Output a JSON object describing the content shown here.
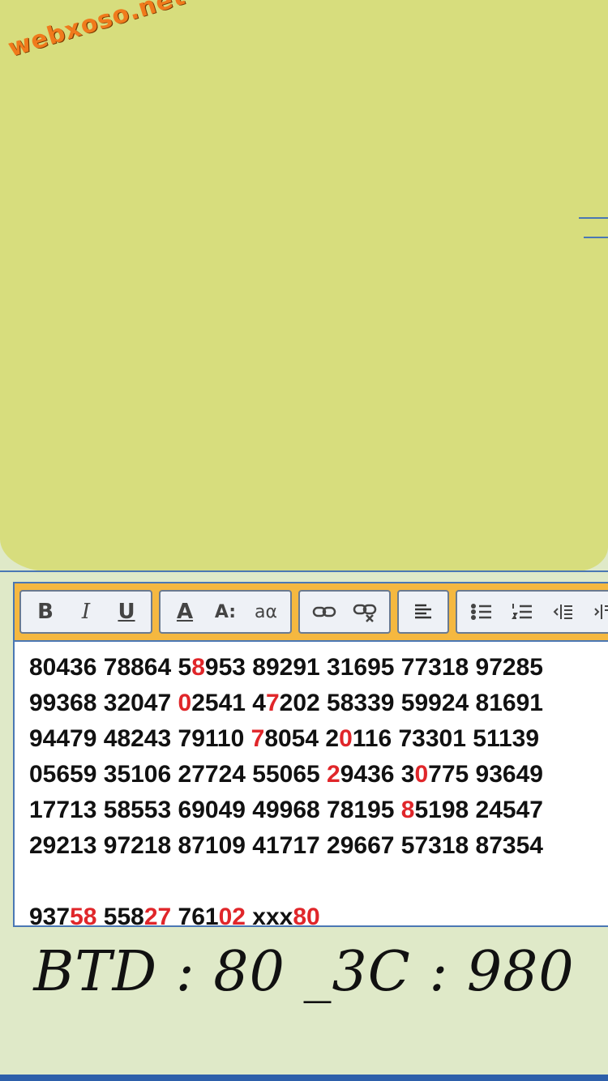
{
  "watermark": "webxoso.net",
  "toolbar": {
    "bold_label": "B",
    "italic_label": "I",
    "underline_label": "U",
    "font_color_label": "A",
    "font_size_label": "A:",
    "case_label": "aα"
  },
  "content": {
    "rows": [
      [
        [
          "80436 78864 5",
          ""
        ],
        [
          "8",
          "red"
        ],
        [
          "953 89291 31695 77318 97285",
          ""
        ]
      ],
      [
        [
          "99368 32047 ",
          ""
        ],
        [
          "0",
          "red"
        ],
        [
          "2541 4",
          ""
        ],
        [
          "7",
          "red"
        ],
        [
          "202 58339 59924 81691",
          ""
        ]
      ],
      [
        [
          "94479 48243 79110 ",
          ""
        ],
        [
          "7",
          "red"
        ],
        [
          "8054 2",
          ""
        ],
        [
          "0",
          "red"
        ],
        [
          "116 73301 51139",
          ""
        ]
      ],
      [
        [
          "05659 35106 27724 55065 ",
          ""
        ],
        [
          "2",
          "red"
        ],
        [
          "9436 3",
          ""
        ],
        [
          "0",
          "red"
        ],
        [
          "775 93649",
          ""
        ]
      ],
      [
        [
          "17713 58553 69049 49968 78195 ",
          ""
        ],
        [
          "8",
          "red"
        ],
        [
          "5198 24547",
          ""
        ]
      ],
      [
        [
          "29213 97218 87109 41717 29667 57318 87354",
          ""
        ]
      ]
    ],
    "result_row": [
      [
        "937",
        ""
      ],
      [
        "58",
        "red"
      ],
      [
        " 558",
        ""
      ],
      [
        "27",
        "red"
      ],
      [
        " 761",
        ""
      ],
      [
        "02",
        "red"
      ],
      [
        " xxx",
        ""
      ],
      [
        "80",
        "red"
      ]
    ]
  },
  "caption": "BTD : 80 _3C : 980",
  "colors": {
    "highlight": "#e0262a",
    "toolbar_bg": "#f5b840",
    "blob": "#d7dd7d",
    "page_bg": "#dfe9c8",
    "border": "#4a77b4"
  }
}
